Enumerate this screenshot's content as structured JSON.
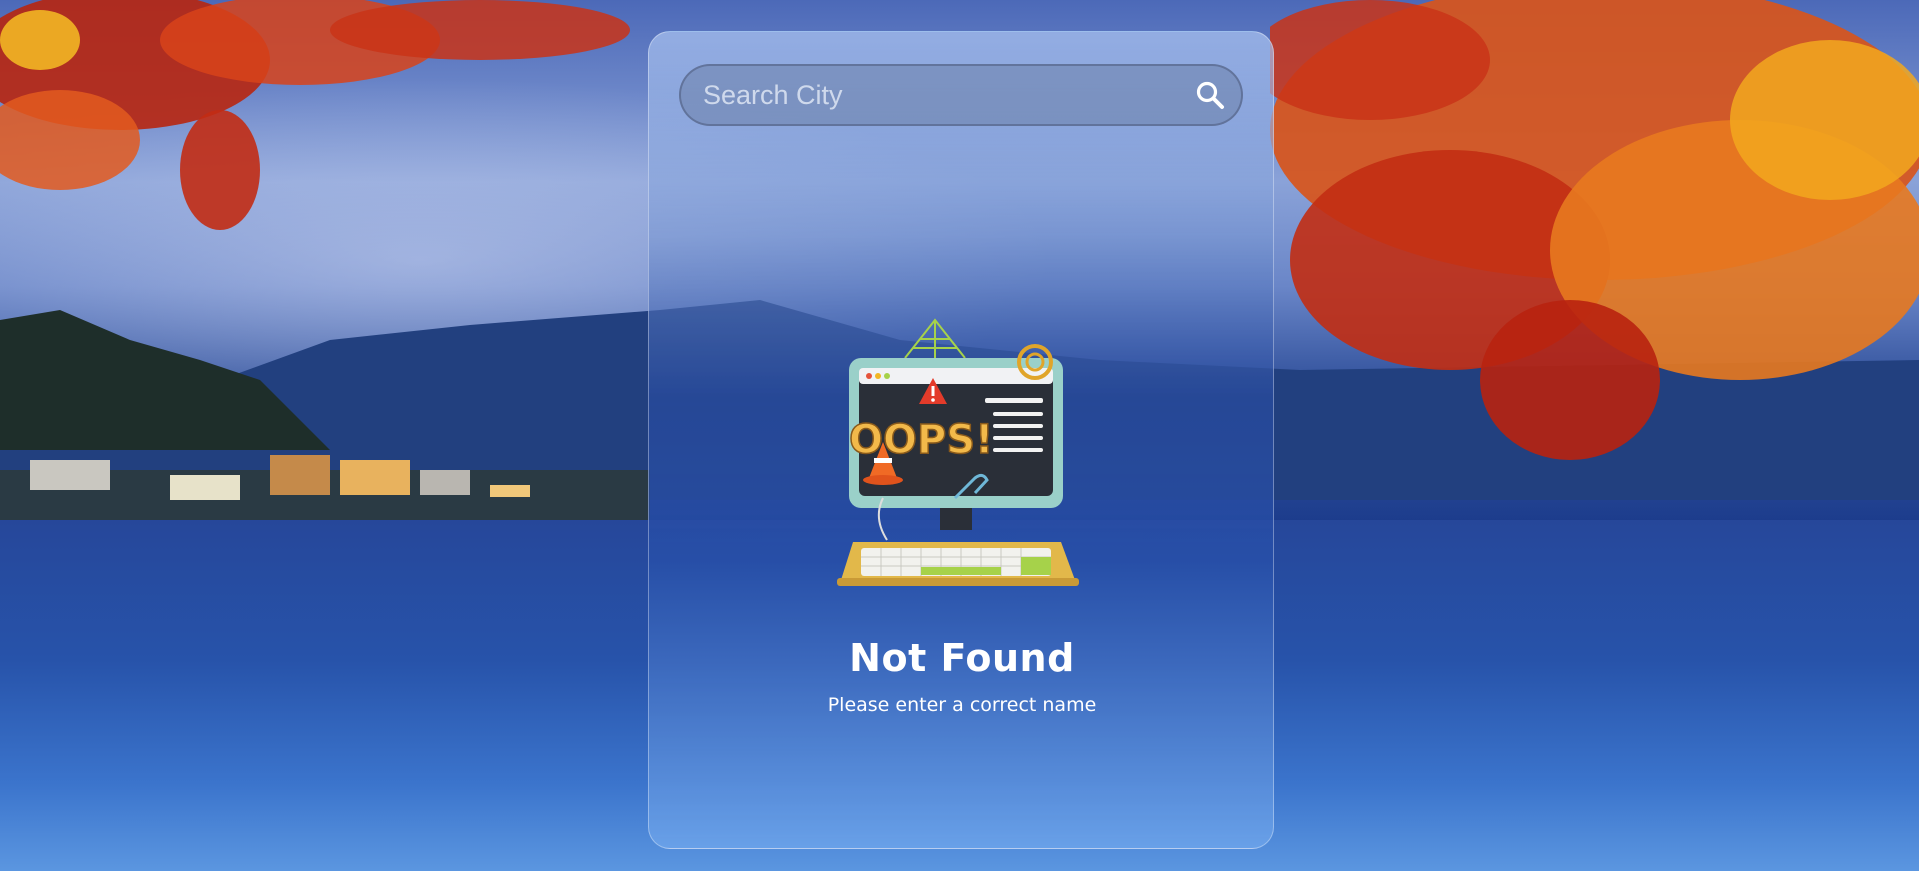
{
  "search": {
    "placeholder": "Search City",
    "value": ""
  },
  "icons": {
    "search_button": "search-icon",
    "illustration": "oops-computer-illustration"
  },
  "illustration": {
    "screen_text": "OOPS!"
  },
  "error": {
    "title": "Not Found",
    "message": "Please enter a correct name"
  },
  "colors": {
    "text": "#ffffff",
    "card_tint": "#4a78c8",
    "leaf_red": "#d8321a",
    "leaf_orange": "#f08a1c"
  }
}
